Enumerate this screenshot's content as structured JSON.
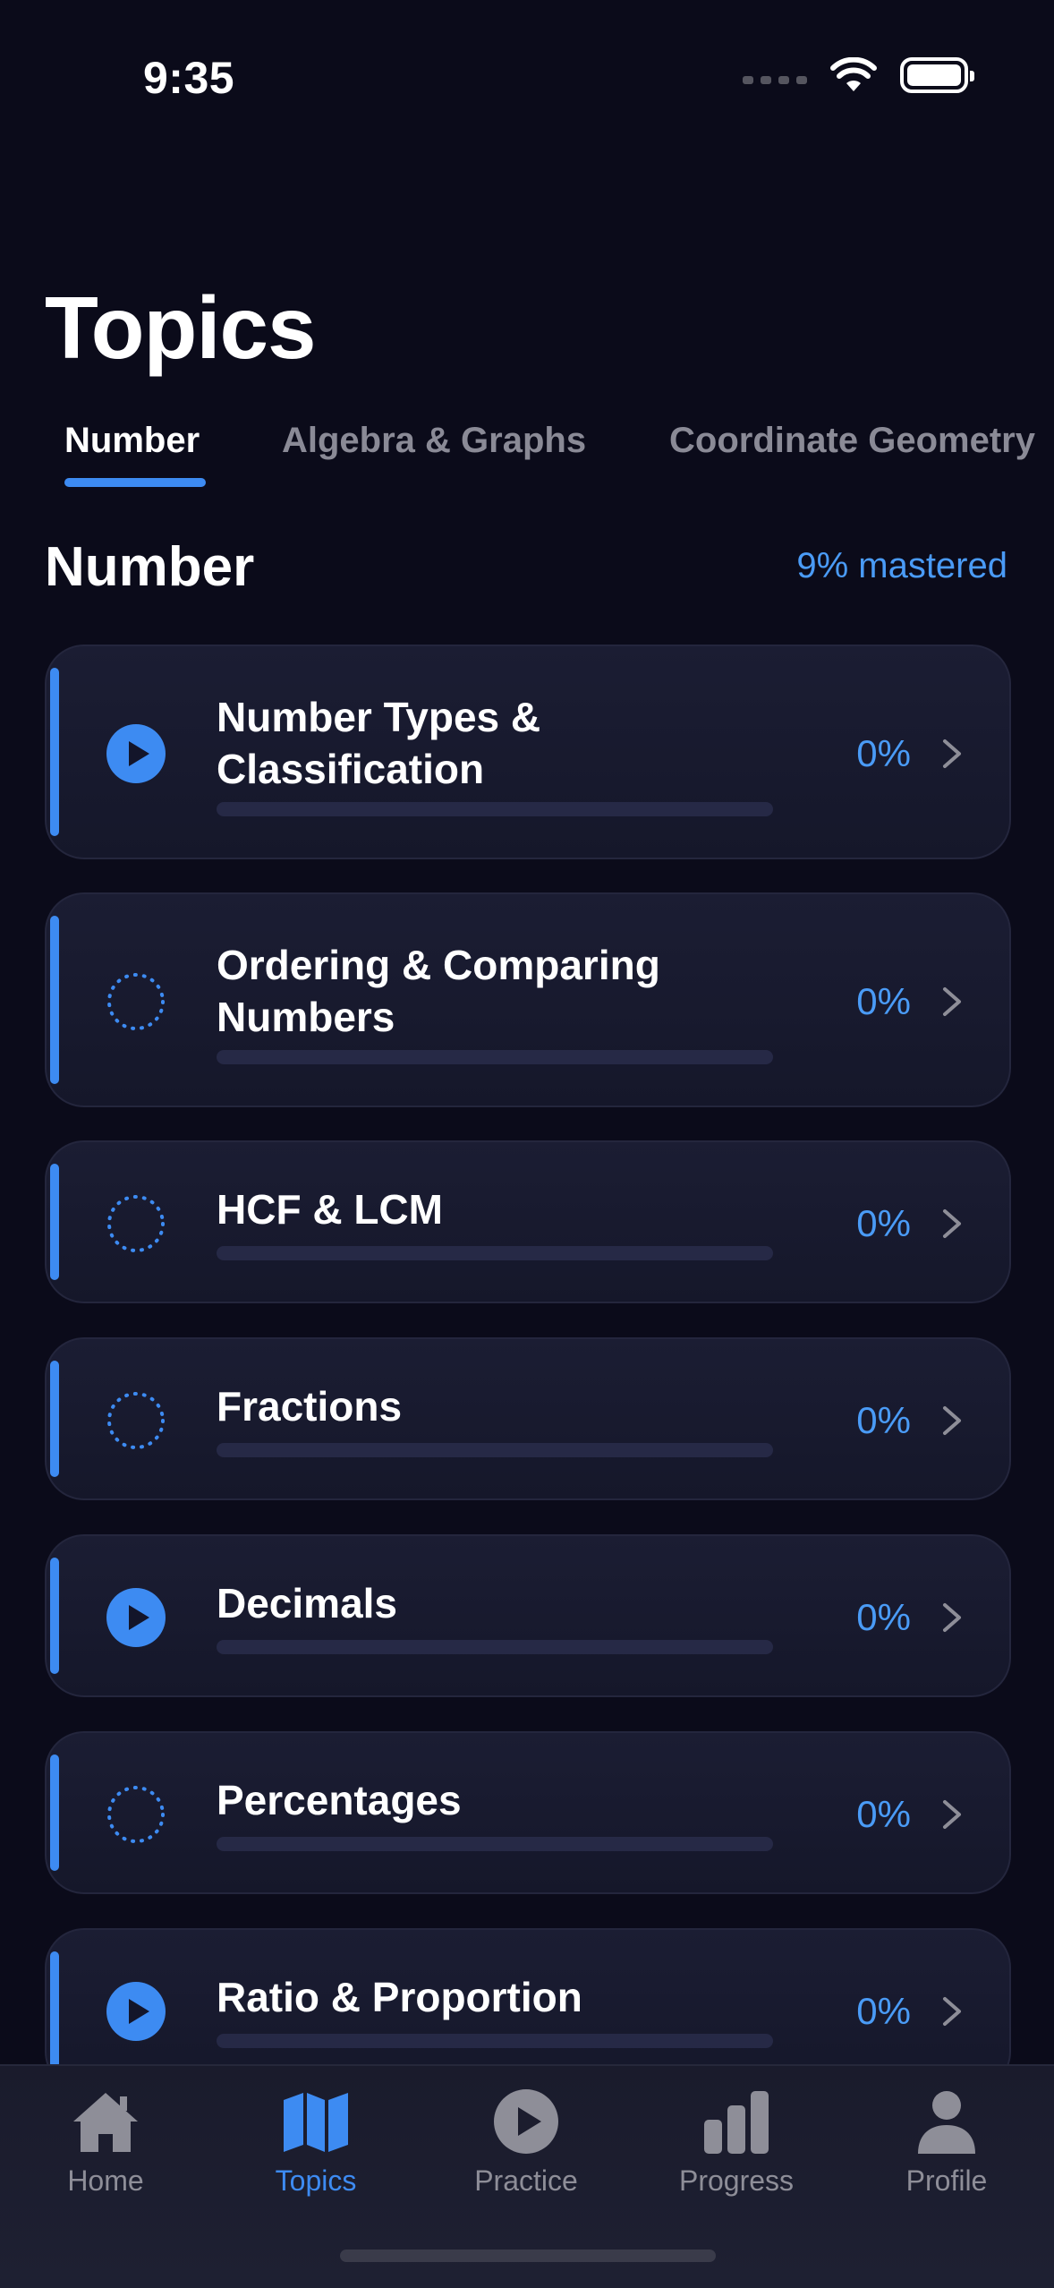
{
  "status_bar": {
    "time": "9:35"
  },
  "page": {
    "title": "Topics"
  },
  "tabs": [
    {
      "label": "Number",
      "active": true
    },
    {
      "label": "Algebra & Graphs",
      "active": false
    },
    {
      "label": "Coordinate Geometry",
      "active": false
    }
  ],
  "section": {
    "title": "Number",
    "mastered": "9% mastered"
  },
  "topics": [
    {
      "title_lines": [
        "Number Types &",
        "Classification"
      ],
      "percent": "0%",
      "progress": 0,
      "status_icon": "play-icon"
    },
    {
      "title_lines": [
        "Ordering & Comparing",
        "Numbers"
      ],
      "percent": "0%",
      "progress": 0,
      "status_icon": "dotted-circle-icon"
    },
    {
      "title_lines": [
        "HCF & LCM"
      ],
      "percent": "0%",
      "progress": 0,
      "status_icon": "dotted-circle-icon"
    },
    {
      "title_lines": [
        "Fractions"
      ],
      "percent": "0%",
      "progress": 0,
      "status_icon": "dotted-circle-icon"
    },
    {
      "title_lines": [
        "Decimals"
      ],
      "percent": "0%",
      "progress": 0,
      "status_icon": "play-icon"
    },
    {
      "title_lines": [
        "Percentages"
      ],
      "percent": "0%",
      "progress": 0,
      "status_icon": "dotted-circle-icon"
    },
    {
      "title_lines": [
        "Ratio & Proportion"
      ],
      "percent": "0%",
      "progress": 0,
      "status_icon": "play-icon"
    }
  ],
  "tabbar": [
    {
      "label": "Home",
      "icon": "home-icon",
      "active": false
    },
    {
      "label": "Topics",
      "icon": "map-icon",
      "active": true
    },
    {
      "label": "Practice",
      "icon": "play-circle-icon",
      "active": false
    },
    {
      "label": "Progress",
      "icon": "bar-chart-icon",
      "active": false
    },
    {
      "label": "Profile",
      "icon": "person-icon",
      "active": false
    }
  ],
  "colors": {
    "background": "#0b0b1a",
    "accent": "#3d8bf2",
    "accent_text": "#4a9bf6",
    "card": "#1b1d33",
    "inactive_text": "#8a8a96"
  }
}
